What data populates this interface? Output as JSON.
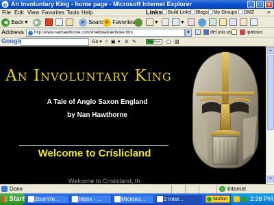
{
  "window": {
    "title": "An Involuntary King - home page - Microsoft Internet Explorer",
    "btn_min": "_",
    "btn_max": "□",
    "btn_close": "×"
  },
  "menubar": {
    "items": [
      "File",
      "Edit",
      "View",
      "Favorites",
      "Tools",
      "Help"
    ],
    "links_label": "Links",
    "links": [
      "Build Links",
      "Blogs",
      "My Groups",
      "DMZ"
    ],
    "more": "»"
  },
  "toolbar": {
    "back": "Back",
    "search": "Search",
    "favorites": "Favorites"
  },
  "addressbar": {
    "label": "Address",
    "url": "http://www.nanhawthorne.com/shieldwall/ak/index.htm",
    "delicious": "del.icio.us",
    "ipassoc": "ipassoc"
  },
  "googlebar": {
    "logo": "Google",
    "go": "Go",
    "pagerank": "PageRank"
  },
  "page": {
    "title": "An Involuntary King",
    "subtitle": "A Tale of Anglo Saxon England",
    "author": "by Nan Hawthorne",
    "welcome": "Welcome to Críslicland",
    "cutoff": "Welcome to Críslicland, th"
  },
  "statusbar": {
    "status": "Done",
    "zone": "Internet"
  },
  "taskbar": {
    "start": "Start",
    "tasks": [
      "ZoomTe...",
      "Inbox - ...",
      "Microso...",
      "2 Inter..."
    ],
    "norton": "Norton",
    "clock": "2:38 PM"
  }
}
